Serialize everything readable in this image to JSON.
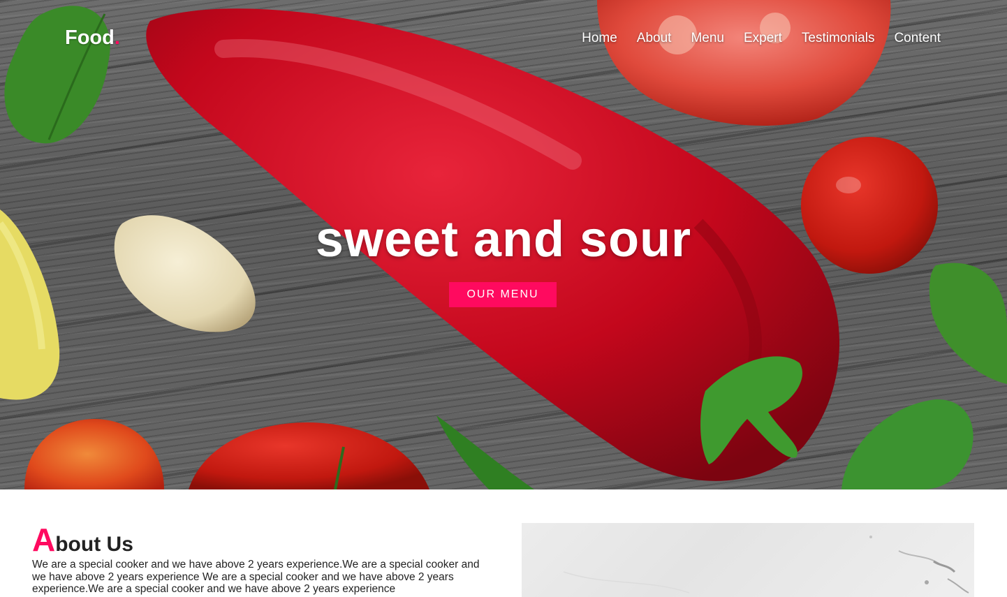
{
  "nav": {
    "logo_text": "Food",
    "logo_dot": ".",
    "items": [
      "Home",
      "About",
      "Menu",
      "Expert",
      "Testimonials",
      "Content"
    ]
  },
  "hero": {
    "headline": "sweet and sour",
    "cta_label": "OUR MENU"
  },
  "about": {
    "title_initial": "A",
    "title_rest": "bout Us",
    "text": "We are a special cooker and we have above 2 years experience.We are a special cooker and we have above 2 years experience We are a special cooker and we have above 2 years experience.We are a special cooker and we have above 2 years experience"
  },
  "colors": {
    "accent": "#ff0a5f",
    "pepper_red": "#c5071a",
    "leaf_green": "#3d8c28"
  }
}
